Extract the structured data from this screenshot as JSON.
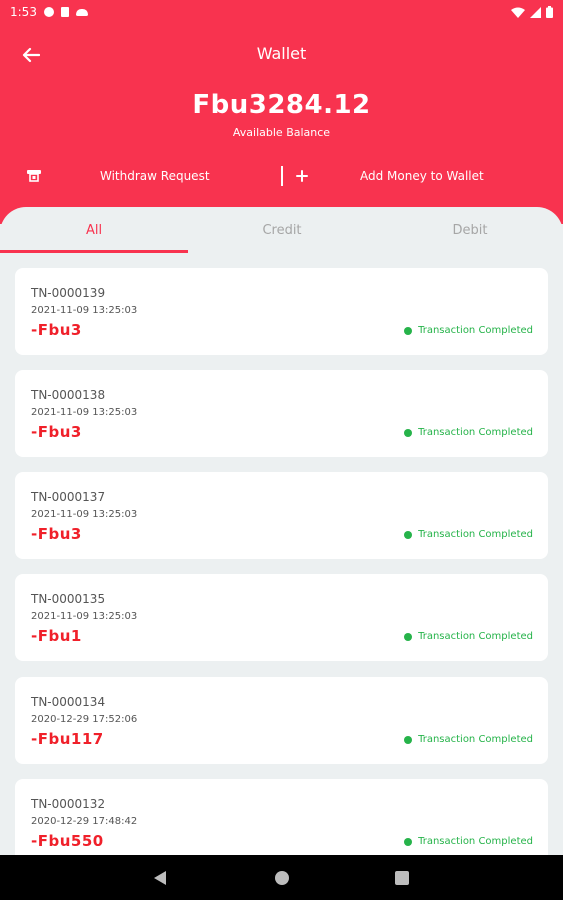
{
  "status_bar": {
    "time": "1:53",
    "left_icons": [
      "p-circle-icon",
      "sim-card-icon",
      "cloud-icon"
    ],
    "right_icons": [
      "wifi-icon",
      "signal-icon",
      "battery-icon"
    ]
  },
  "header": {
    "title": "Wallet",
    "balance": "Fbu3284.12",
    "balance_label": "Available Balance",
    "back_icon": "arrow-left-icon",
    "withdraw_label": "Withdraw Request",
    "add_money_label": "Add Money to Wallet",
    "colors": {
      "brand": "#f8334f",
      "negative": "#f0202a",
      "success": "#26b34a"
    }
  },
  "tabs": [
    {
      "label": "All",
      "active": true
    },
    {
      "label": "Credit",
      "active": false
    },
    {
      "label": "Debit",
      "active": false
    }
  ],
  "transactions": [
    {
      "id": "TN-0000139",
      "date": "2021-11-09 13:25:03",
      "amount": "-Fbu3",
      "status": "Transaction Completed"
    },
    {
      "id": "TN-0000138",
      "date": "2021-11-09 13:25:03",
      "amount": "-Fbu3",
      "status": "Transaction Completed"
    },
    {
      "id": "TN-0000137",
      "date": "2021-11-09 13:25:03",
      "amount": "-Fbu3",
      "status": "Transaction Completed"
    },
    {
      "id": "TN-0000135",
      "date": "2021-11-09 13:25:03",
      "amount": "-Fbu1",
      "status": "Transaction Completed"
    },
    {
      "id": "TN-0000134",
      "date": "2020-12-29 17:52:06",
      "amount": "-Fbu117",
      "status": "Transaction Completed"
    },
    {
      "id": "TN-0000132",
      "date": "2020-12-29 17:48:42",
      "amount": "-Fbu550",
      "status": "Transaction Completed"
    }
  ],
  "nav": [
    "back-triangle-icon",
    "home-circle-icon",
    "recents-square-icon"
  ]
}
